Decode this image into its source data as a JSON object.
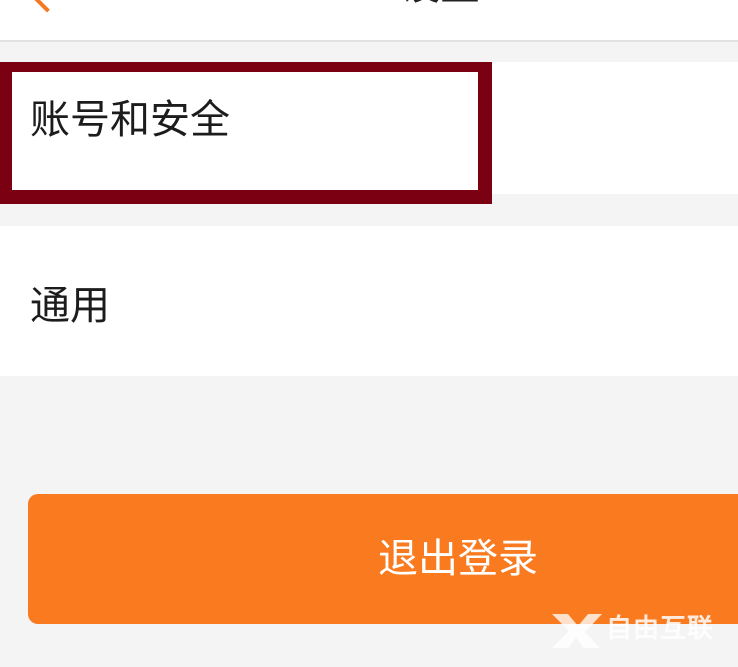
{
  "header": {
    "title": "设置"
  },
  "settings": {
    "items": [
      {
        "label": "账号和安全"
      },
      {
        "label": "通用"
      }
    ]
  },
  "logout": {
    "label": "退出登录"
  },
  "watermark": {
    "text": "自由互联"
  },
  "colors": {
    "accent": "#f97a1f",
    "highlight": "#7a0012",
    "background": "#f4f4f4"
  }
}
